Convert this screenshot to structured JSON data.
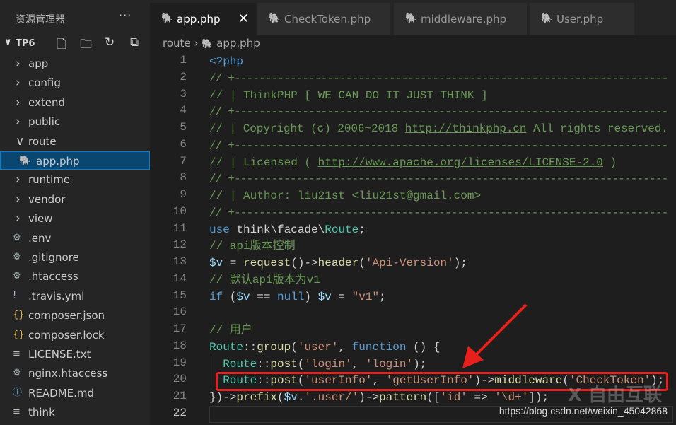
{
  "sidebar": {
    "title": "资源管理器",
    "more": "···",
    "project": "TP6",
    "items": [
      {
        "label": "app",
        "type": "folder",
        "icon": "chevron-right"
      },
      {
        "label": "config",
        "type": "folder",
        "icon": "chevron-right"
      },
      {
        "label": "extend",
        "type": "folder",
        "icon": "chevron-right"
      },
      {
        "label": "public",
        "type": "folder",
        "icon": "chevron-right"
      },
      {
        "label": "route",
        "type": "folder",
        "icon": "chevron-down"
      },
      {
        "label": "app.php",
        "type": "php",
        "icon": "php-elephant",
        "selected": true
      },
      {
        "label": "runtime",
        "type": "folder",
        "icon": "chevron-right"
      },
      {
        "label": "vendor",
        "type": "folder",
        "icon": "chevron-right"
      },
      {
        "label": "view",
        "type": "folder",
        "icon": "chevron-right"
      },
      {
        "label": ".env",
        "type": "gear",
        "icon": "gear"
      },
      {
        "label": ".gitignore",
        "type": "gear",
        "icon": "gear"
      },
      {
        "label": ".htaccess",
        "type": "gear",
        "icon": "gear"
      },
      {
        "label": ".travis.yml",
        "type": "yml",
        "icon": "exclamation"
      },
      {
        "label": "composer.json",
        "type": "json",
        "icon": "braces"
      },
      {
        "label": "composer.lock",
        "type": "json",
        "icon": "braces"
      },
      {
        "label": "LICENSE.txt",
        "type": "txt",
        "icon": "lines"
      },
      {
        "label": "nginx.htaccess",
        "type": "gear",
        "icon": "gear"
      },
      {
        "label": "README.md",
        "type": "md",
        "icon": "info"
      },
      {
        "label": "think",
        "type": "txt",
        "icon": "lines"
      }
    ]
  },
  "tabs": [
    {
      "label": "app.php",
      "active": true
    },
    {
      "label": "CheckToken.php"
    },
    {
      "label": "middleware.php"
    },
    {
      "label": "User.php"
    }
  ],
  "breadcrumb": [
    "route",
    "app.php"
  ],
  "code": [
    [
      [
        "k",
        "<?php"
      ]
    ],
    [
      [
        "c",
        "// +----------------------------------------------------------------------"
      ]
    ],
    [
      [
        "c",
        "// | ThinkPHP [ WE CAN DO IT JUST THINK ]"
      ]
    ],
    [
      [
        "c",
        "// +----------------------------------------------------------------------"
      ]
    ],
    [
      [
        "c",
        "// | Copyright (c) 2006~2018 "
      ],
      [
        "u",
        "http://thinkphp.cn"
      ],
      [
        "c",
        " All rights reserved."
      ]
    ],
    [
      [
        "c",
        "// +----------------------------------------------------------------------"
      ]
    ],
    [
      [
        "c",
        "// | Licensed ( "
      ],
      [
        "u",
        "http://www.apache.org/licenses/LICENSE-2.0"
      ],
      [
        "c",
        " )"
      ]
    ],
    [
      [
        "c",
        "// +----------------------------------------------------------------------"
      ]
    ],
    [
      [
        "c",
        "// | Author: liu21st <liu21st@gmail.com>"
      ]
    ],
    [
      [
        "c",
        "// +----------------------------------------------------------------------"
      ]
    ],
    [
      [
        "k",
        "use"
      ],
      [
        "d",
        " think\\facade\\"
      ],
      [
        "t",
        "Route"
      ],
      [
        "d",
        ";"
      ]
    ],
    [
      [
        "c",
        "// api版本控制"
      ]
    ],
    [
      [
        "v",
        "$v"
      ],
      [
        "d",
        " = "
      ],
      [
        "f",
        "request"
      ],
      [
        "d",
        "()->"
      ],
      [
        "f",
        "header"
      ],
      [
        "d",
        "("
      ],
      [
        "s",
        "'Api-Version'"
      ],
      [
        "d",
        ");"
      ]
    ],
    [
      [
        "c",
        "// 默认api版本为v1"
      ]
    ],
    [
      [
        "k",
        "if"
      ],
      [
        "d",
        " ("
      ],
      [
        "v",
        "$v"
      ],
      [
        "d",
        " == "
      ],
      [
        "k",
        "null"
      ],
      [
        "d",
        ") "
      ],
      [
        "v",
        "$v"
      ],
      [
        "d",
        " = "
      ],
      [
        "s",
        "\"v1\""
      ],
      [
        "d",
        ";"
      ]
    ],
    [],
    [
      [
        "c",
        "// 用户"
      ]
    ],
    [
      [
        "t",
        "Route"
      ],
      [
        "d",
        "::"
      ],
      [
        "f",
        "group"
      ],
      [
        "d",
        "("
      ],
      [
        "s",
        "'user'"
      ],
      [
        "d",
        ", "
      ],
      [
        "k",
        "function"
      ],
      [
        "d",
        " () {"
      ]
    ],
    [
      [
        "d",
        "  "
      ],
      [
        "t",
        "Route"
      ],
      [
        "d",
        "::"
      ],
      [
        "f",
        "post"
      ],
      [
        "d",
        "("
      ],
      [
        "s",
        "'login'"
      ],
      [
        "d",
        ", "
      ],
      [
        "s",
        "'login'"
      ],
      [
        "d",
        ");"
      ]
    ],
    [
      [
        "d",
        "  "
      ],
      [
        "t",
        "Route"
      ],
      [
        "d",
        "::"
      ],
      [
        "f",
        "post"
      ],
      [
        "d",
        "("
      ],
      [
        "s",
        "'userInfo'"
      ],
      [
        "d",
        ", "
      ],
      [
        "s",
        "'getUserInfo'"
      ],
      [
        "d",
        ")->"
      ],
      [
        "f",
        "middleware"
      ],
      [
        "d",
        "("
      ],
      [
        "s",
        "'CheckToken'"
      ],
      [
        "d",
        ");"
      ]
    ],
    [
      [
        "d",
        "})->"
      ],
      [
        "f",
        "prefix"
      ],
      [
        "d",
        "("
      ],
      [
        "v",
        "$v"
      ],
      [
        "d",
        "."
      ],
      [
        "s",
        "'.user/'"
      ],
      [
        "d",
        ")->"
      ],
      [
        "f",
        "pattern"
      ],
      [
        "d",
        "(["
      ],
      [
        "s",
        "'id'"
      ],
      [
        "d",
        " => "
      ],
      [
        "s",
        "'\\d+'"
      ],
      [
        "d",
        "]);"
      ]
    ],
    []
  ],
  "current_line": 22,
  "highlighted_line": 20,
  "watermark": {
    "text": "https://blog.csdn.net/weixin_45042868",
    "logo": "自由互联"
  },
  "colors": {
    "accent": "#007fd4",
    "highlight_box": "#e8201b",
    "php_icon": "#a074c4"
  }
}
